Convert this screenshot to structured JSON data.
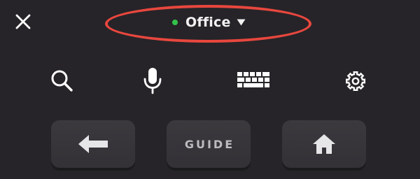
{
  "header": {
    "device_name": "Office",
    "status": "online",
    "status_color": "#35c24a",
    "highlight_color": "#e8473e"
  },
  "toolbar": {
    "icons": [
      "search-icon",
      "microphone-icon",
      "keyboard-icon",
      "settings-gear-icon"
    ]
  },
  "remote": {
    "back_icon": "arrow-left-icon",
    "guide_label": "GUIDE",
    "home_icon": "home-icon"
  },
  "colors": {
    "background": "#262428",
    "button": "#38363b",
    "icon": "#ffffff"
  }
}
